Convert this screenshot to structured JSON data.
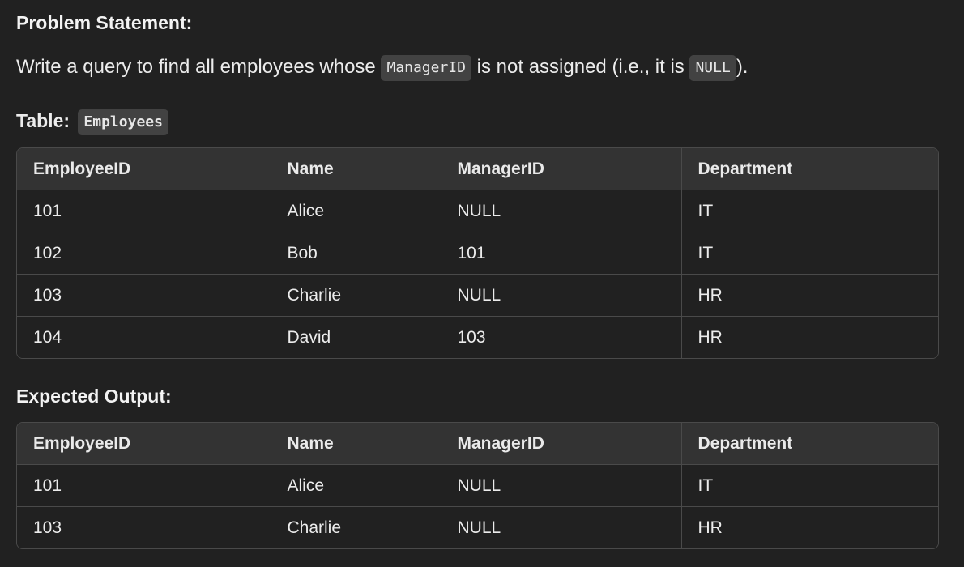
{
  "problem_heading": "Problem Statement:",
  "statement": {
    "before": "Write a query to find all employees whose ",
    "code1": "ManagerID",
    "middle": " is not assigned (i.e., it is ",
    "code2": "NULL",
    "after": ")."
  },
  "table_label": {
    "prefix": "Table:",
    "name": "Employees"
  },
  "employees_table": {
    "headers": [
      "EmployeeID",
      "Name",
      "ManagerID",
      "Department"
    ],
    "rows": [
      [
        "101",
        "Alice",
        "NULL",
        "IT"
      ],
      [
        "102",
        "Bob",
        "101",
        "IT"
      ],
      [
        "103",
        "Charlie",
        "NULL",
        "HR"
      ],
      [
        "104",
        "David",
        "103",
        "HR"
      ]
    ]
  },
  "output_heading": "Expected Output:",
  "output_table": {
    "headers": [
      "EmployeeID",
      "Name",
      "ManagerID",
      "Department"
    ],
    "rows": [
      [
        "101",
        "Alice",
        "NULL",
        "IT"
      ],
      [
        "103",
        "Charlie",
        "NULL",
        "HR"
      ]
    ]
  }
}
